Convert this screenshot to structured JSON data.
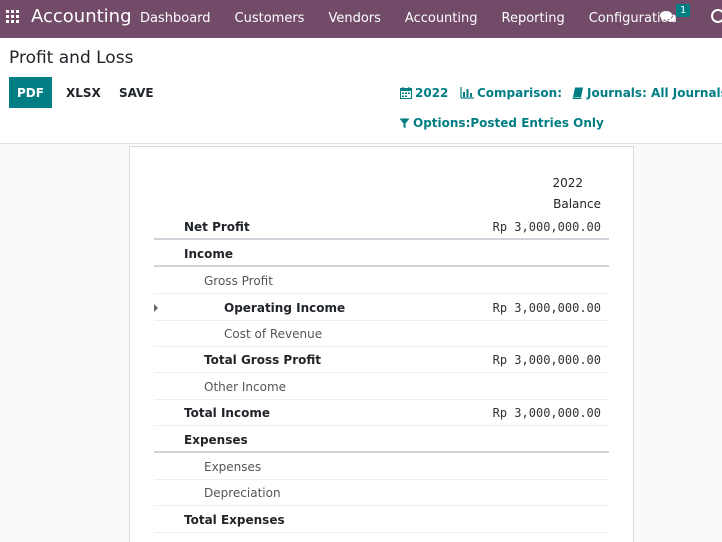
{
  "navbar": {
    "brand": "Accounting",
    "menu": [
      "Dashboard",
      "Customers",
      "Vendors",
      "Accounting",
      "Reporting",
      "Configuration"
    ],
    "chat_badge": "1"
  },
  "control": {
    "title": "Profit and Loss",
    "buttons": {
      "pdf": "PDF",
      "xlsx": "XLSX",
      "save": "SAVE"
    },
    "filters": {
      "date": "2022",
      "comparison": "Comparison:",
      "journals": "Journals: All Journals",
      "options": "Options:Posted Entries Only"
    }
  },
  "report": {
    "column_year": "2022",
    "column_label": "Balance",
    "rows": [
      {
        "label": "Net Profit",
        "value": "Rp 3,000,000.00"
      },
      {
        "label": "Income",
        "value": ""
      },
      {
        "label": "Gross Profit",
        "value": ""
      },
      {
        "label": "Operating Income",
        "value": "Rp 3,000,000.00"
      },
      {
        "label": "Cost of Revenue",
        "value": ""
      },
      {
        "label": "Total Gross Profit",
        "value": "Rp 3,000,000.00"
      },
      {
        "label": "Other Income",
        "value": ""
      },
      {
        "label": "Total Income",
        "value": "Rp 3,000,000.00"
      },
      {
        "label": "Expenses",
        "value": ""
      },
      {
        "label": "Expenses",
        "value": ""
      },
      {
        "label": "Depreciation",
        "value": ""
      },
      {
        "label": "Total Expenses",
        "value": ""
      }
    ]
  }
}
